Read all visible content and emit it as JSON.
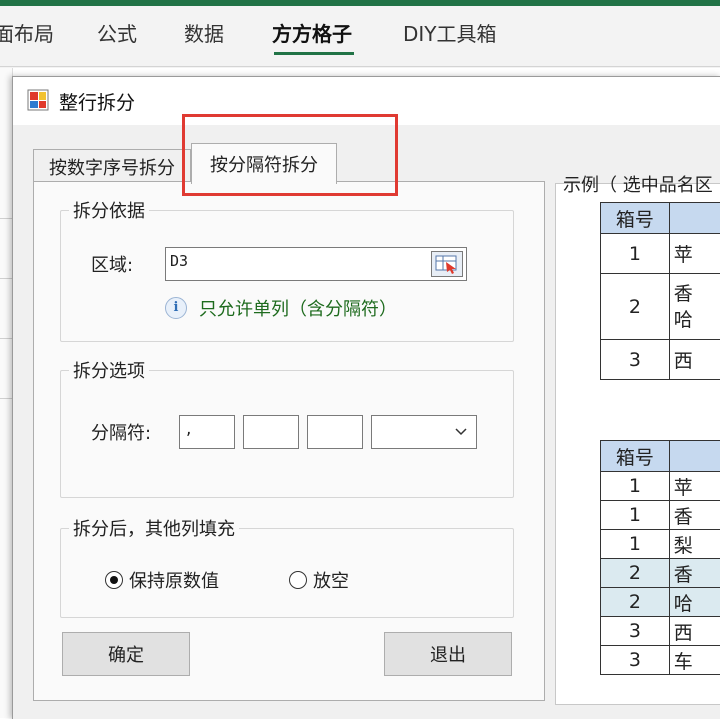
{
  "ribbon": {
    "tabs": [
      "页面布局",
      "公式",
      "数据",
      "方方格子",
      "DIY工具箱"
    ],
    "tab_visible": [
      "面布局",
      "公式",
      "数据",
      "方方格子",
      "DIY工具箱"
    ],
    "active_tab": "方方格子",
    "accent": "#217346"
  },
  "dialog": {
    "title": "整行拆分",
    "tabs": [
      {
        "label": "按数字序号拆分",
        "active": false
      },
      {
        "label": "按分隔符拆分",
        "active": true
      }
    ],
    "highlight_color": "#e03a32",
    "basis_group": {
      "label": "拆分依据",
      "range_label": "区域:",
      "range_value": "D3",
      "info_text": "只允许单列（含分隔符）",
      "info_color": "#1e6b1e"
    },
    "options_group": {
      "label": "拆分选项",
      "separator_label": "分隔符:",
      "separators": [
        ",",
        "",
        ""
      ],
      "separator_select": ""
    },
    "fill_group": {
      "label": "拆分后，其他列填充",
      "options": [
        {
          "label": "保持原数值",
          "checked": true
        },
        {
          "label": "放空",
          "checked": false
        }
      ]
    },
    "buttons": {
      "ok": "确定",
      "exit": "退出"
    }
  },
  "example": {
    "title": "示例（ 选中品名区",
    "table_before": {
      "header": [
        "箱号",
        ""
      ],
      "rows": [
        {
          "no": "1",
          "name": "苹"
        },
        {
          "no": "2",
          "name": "香\n哈"
        },
        {
          "no": "3",
          "name": "西"
        }
      ]
    },
    "table_after": {
      "header": [
        "箱号",
        ""
      ],
      "rows": [
        {
          "no": "1",
          "name": "苹",
          "shade": false
        },
        {
          "no": "1",
          "name": "香",
          "shade": false
        },
        {
          "no": "1",
          "name": "梨",
          "shade": false
        },
        {
          "no": "2",
          "name": "香",
          "shade": true
        },
        {
          "no": "2",
          "name": "哈",
          "shade": true
        },
        {
          "no": "3",
          "name": "西",
          "shade": false
        },
        {
          "no": "3",
          "name": "车",
          "shade": false
        }
      ]
    }
  }
}
